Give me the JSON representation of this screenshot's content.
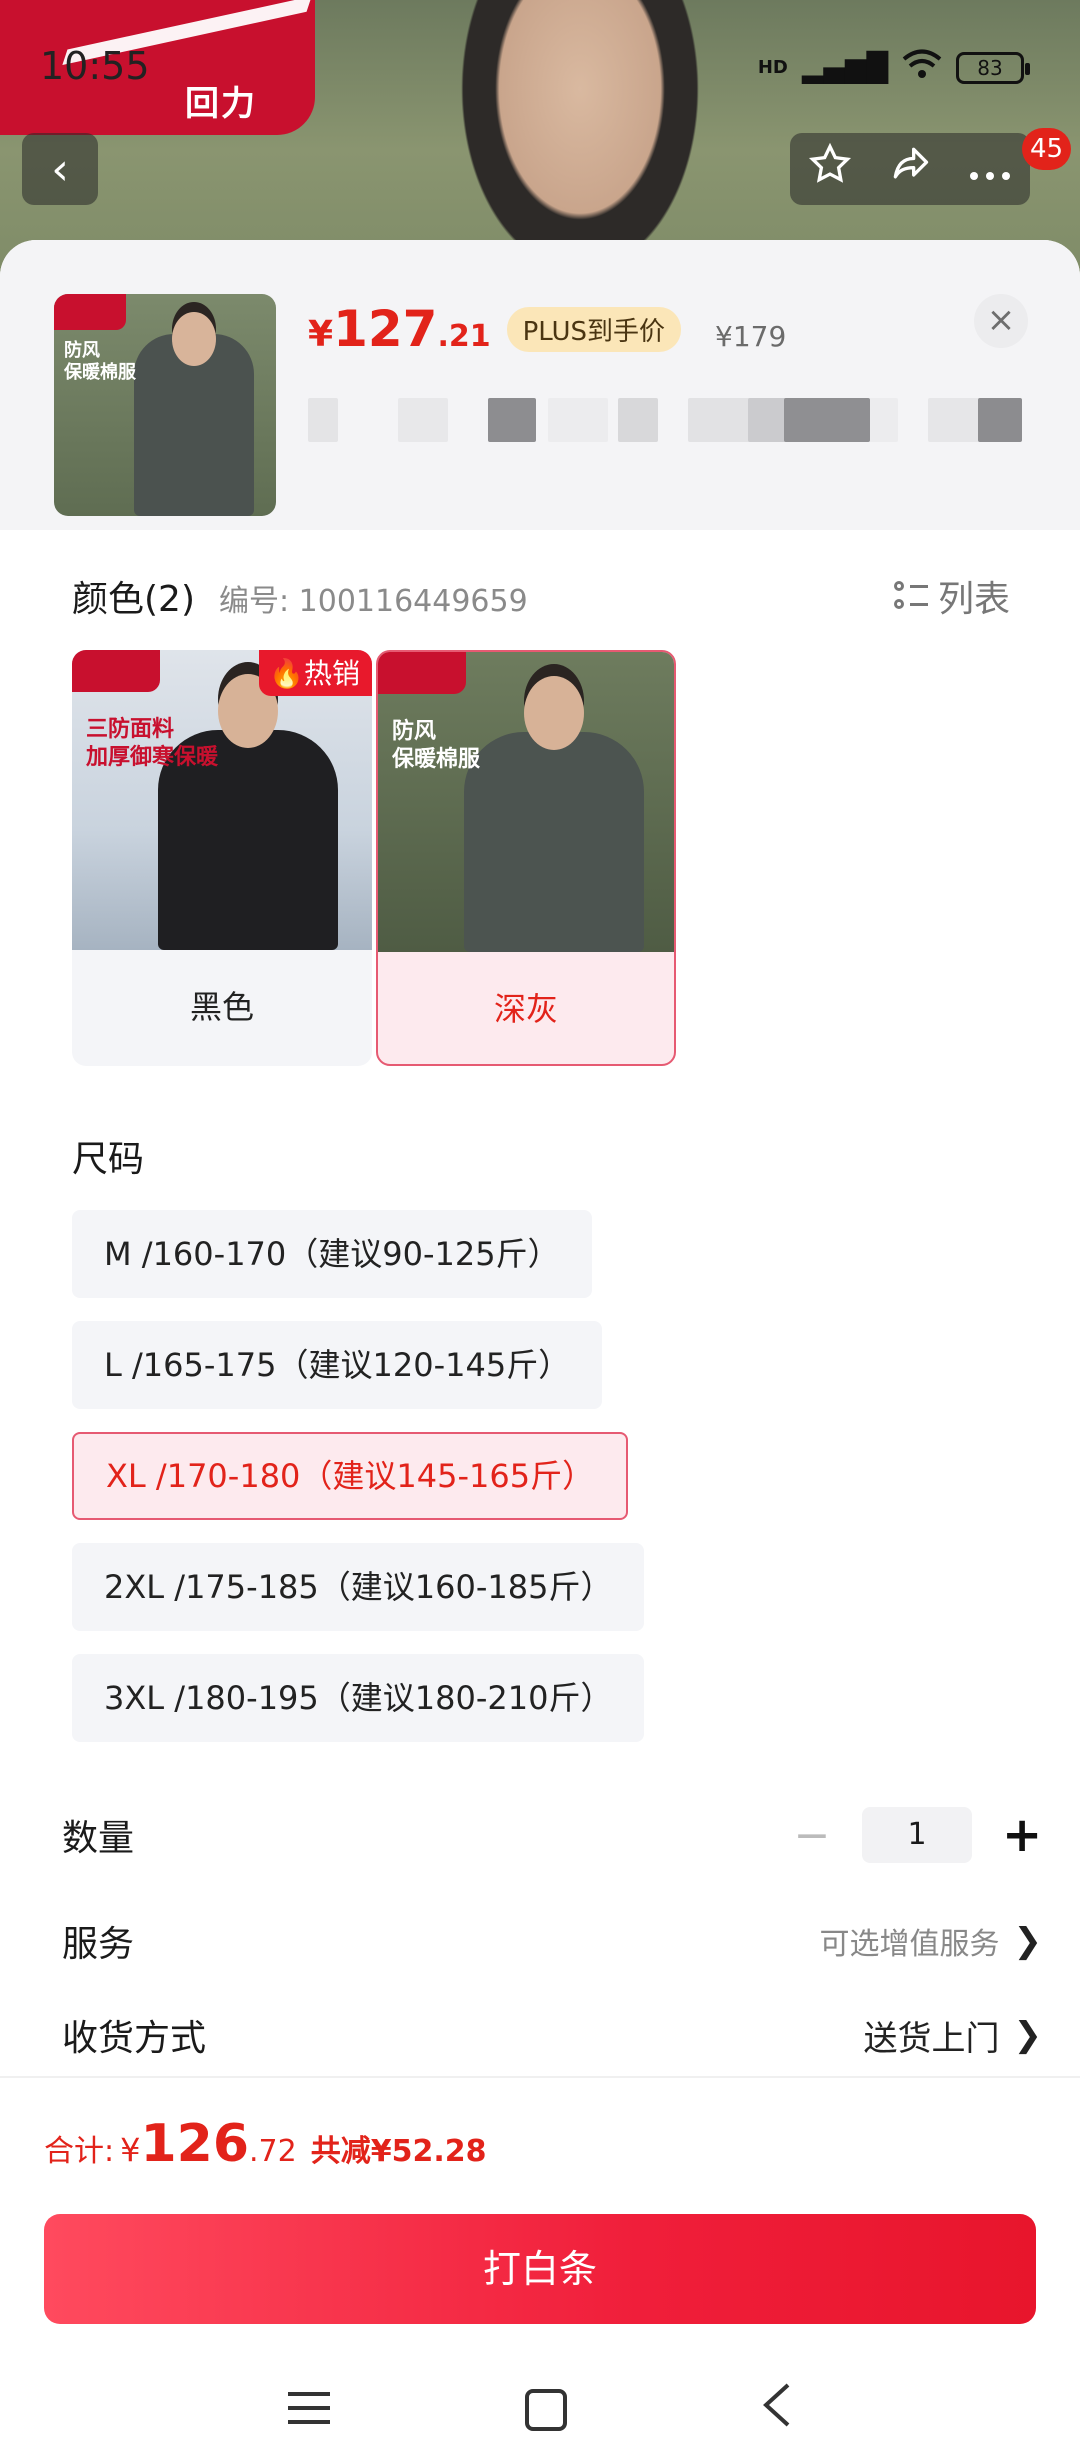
{
  "status": {
    "time": "10:55",
    "network": "HD",
    "battery": "83"
  },
  "top": {
    "back_glyph": "‹",
    "cart_badge": "45",
    "brand_text": "回力"
  },
  "product": {
    "thumb_tag": "防风\n保暖棉服",
    "price_yen": "¥",
    "price_int": "127",
    "price_dec": ".21",
    "plus_label": "PLUS到手价",
    "original_price": "¥179"
  },
  "color_section": {
    "title": "颜色(2)",
    "item_no": "编号: 100116449659",
    "list_label": "列表",
    "options": [
      {
        "label": "黑色",
        "badge": "热销",
        "feature": "三防面料\n加厚御寒保暖",
        "selected": false
      },
      {
        "label": "深灰",
        "badge": "",
        "feature": "防风\n保暖棉服",
        "selected": true
      }
    ]
  },
  "size_section": {
    "title": "尺码",
    "options": [
      {
        "label": "M /160-170（建议90-125斤）",
        "selected": false
      },
      {
        "label": "L /165-175（建议120-145斤）",
        "selected": false
      },
      {
        "label": "XL /170-180（建议145-165斤）",
        "selected": true
      },
      {
        "label": "2XL /175-185（建议160-185斤）",
        "selected": false
      },
      {
        "label": "3XL /180-195（建议180-210斤）",
        "selected": false
      }
    ]
  },
  "quantity": {
    "label": "数量",
    "minus": "−",
    "value": "1",
    "plus": "+"
  },
  "service": {
    "label": "服务",
    "value": "可选增值服务",
    "chevron": "❯"
  },
  "delivery": {
    "label": "收货方式",
    "value": "送货上门",
    "chevron": "❯"
  },
  "footer": {
    "total_label": "合计:",
    "total_yen": "¥",
    "total_int": "126",
    "total_dec": ".72",
    "savings": "共减¥52.28",
    "buy_label": "打白条"
  },
  "colors": {
    "accent": "#e2231a",
    "brand": "#c8102e",
    "selected_bg": "#fdeaee",
    "option_bg": "#f4f5f8"
  }
}
